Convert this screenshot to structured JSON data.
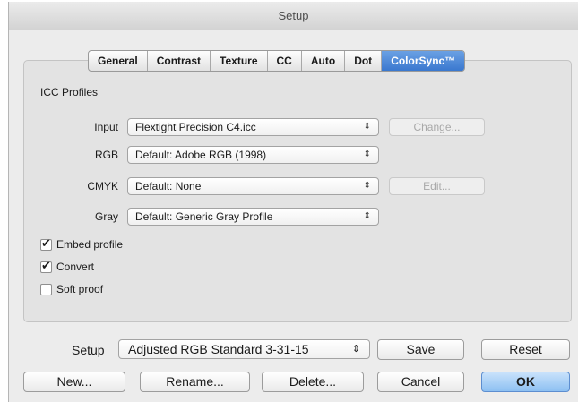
{
  "window": {
    "title": "Setup"
  },
  "tabs": [
    {
      "label": "General"
    },
    {
      "label": "Contrast"
    },
    {
      "label": "Texture"
    },
    {
      "label": "CC"
    },
    {
      "label": "Auto"
    },
    {
      "label": "Dot"
    },
    {
      "label": "ColorSync™",
      "active": true
    }
  ],
  "icc": {
    "section_title": "ICC Profiles",
    "rows": [
      {
        "label": "Input",
        "value": "Flextight Precision C4.icc",
        "button": "Change..."
      },
      {
        "label": "RGB",
        "value": "Default: Adobe RGB (1998)"
      },
      {
        "label": "CMYK",
        "value": "Default: None",
        "button": "Edit..."
      },
      {
        "label": "Gray",
        "value": "Default: Generic Gray Profile"
      }
    ]
  },
  "checkboxes": [
    {
      "label": "Embed profile",
      "checked": true
    },
    {
      "label": "Convert",
      "checked": true
    },
    {
      "label": "Soft proof",
      "checked": false
    }
  ],
  "setup": {
    "label": "Setup",
    "value": "Adjusted RGB Standard 3-31-15",
    "save": "Save",
    "reset": "Reset"
  },
  "footer": {
    "new": "New...",
    "rename": "Rename...",
    "delete": "Delete...",
    "cancel": "Cancel",
    "ok": "OK"
  },
  "icons": {
    "popup_arrows": "⌃⌄",
    "check": "checkmark-icon"
  }
}
